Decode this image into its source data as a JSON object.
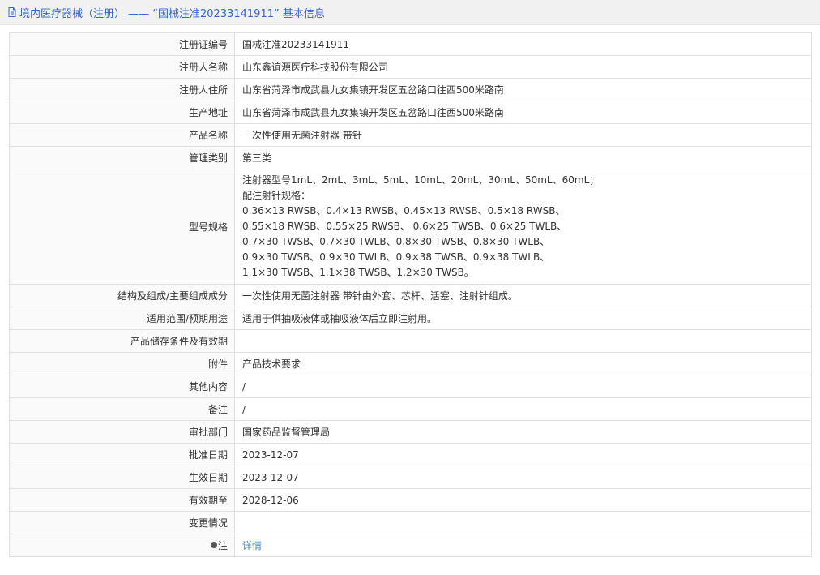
{
  "header": {
    "title": "境内医疗器械（注册） —— “国械注准20233141911” 基本信息",
    "icon": "document-icon"
  },
  "rows": [
    {
      "label": "注册证编号",
      "value": "国械注准20233141911"
    },
    {
      "label": "注册人名称",
      "value": "山东鑫谊源医疗科技股份有限公司"
    },
    {
      "label": "注册人住所",
      "value": "山东省菏泽市成武县九女集镇开发区五岔路口往西500米路南"
    },
    {
      "label": "生产地址",
      "value": "山东省菏泽市成武县九女集镇开发区五岔路口往西500米路南"
    },
    {
      "label": "产品名称",
      "value": "一次性使用无菌注射器 带针"
    },
    {
      "label": "管理类别",
      "value": "第三类"
    }
  ],
  "spec": {
    "label": "型号规格",
    "lines": [
      "注射器型号1mL、2mL、3mL、5mL、10mL、20mL、30mL、50mL、60mL；",
      "配注射针规格：",
      "0.36×13 RWSB、0.4×13 RWSB、0.45×13 RWSB、0.5×18 RWSB、",
      "0.55×18 RWSB、0.55×25 RWSB、 0.6×25 TWSB、0.6×25 TWLB、",
      "0.7×30 TWSB、0.7×30 TWLB、0.8×30 TWSB、0.8×30 TWLB、",
      "0.9×30 TWSB、0.9×30 TWLB、0.9×38 TWSB、0.9×38 TWLB、",
      "1.1×30 TWSB、1.1×38 TWSB、1.2×30 TWSB。"
    ]
  },
  "rows2": [
    {
      "label": "结构及组成/主要组成成分",
      "value": "一次性使用无菌注射器 带针由外套、芯杆、活塞、注射针组成。"
    },
    {
      "label": "适用范围/预期用途",
      "value": "适用于供抽吸液体或抽吸液体后立即注射用。"
    },
    {
      "label": "产品储存条件及有效期",
      "value": ""
    },
    {
      "label": "附件",
      "value": "产品技术要求"
    },
    {
      "label": "其他内容",
      "value": "/"
    },
    {
      "label": "备注",
      "value": "/"
    },
    {
      "label": "审批部门",
      "value": "国家药品监督管理局"
    },
    {
      "label": "批准日期",
      "value": "2023-12-07"
    },
    {
      "label": "生效日期",
      "value": "2023-12-07"
    },
    {
      "label": "有效期至",
      "value": "2028-12-06"
    },
    {
      "label": "变更情况",
      "value": ""
    }
  ],
  "note": {
    "label": "注",
    "link": "详情",
    "icon": "pin-icon"
  }
}
